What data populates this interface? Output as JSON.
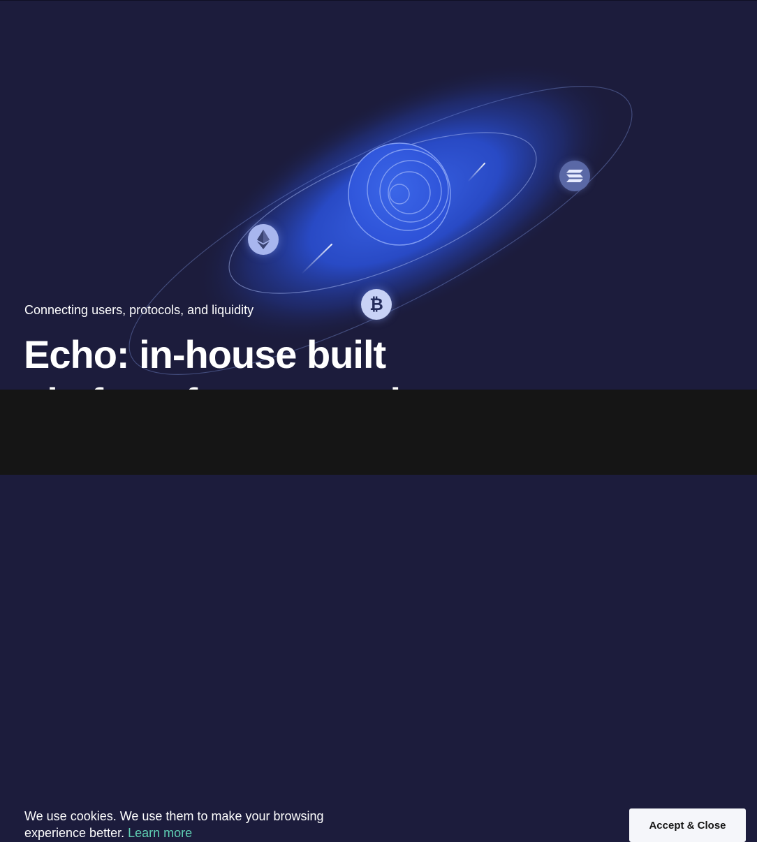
{
  "hero": {
    "tagline": "Connecting users, protocols, and liquidity",
    "headline": "Echo: in-house built platform for connecting"
  },
  "coins": [
    {
      "name": "ethereum",
      "icon": "ethereum-icon"
    },
    {
      "name": "bitcoin",
      "icon": "bitcoin-icon"
    },
    {
      "name": "solana",
      "icon": "solana-icon"
    }
  ],
  "cookie_banner": {
    "message": "We use cookies. We use them to make your browsing experience better.",
    "learn_more": "Learn more",
    "accept_label": "Accept & Close"
  },
  "colors": {
    "background": "#1c1c3c",
    "glow": "#2f52d6",
    "accent_link": "#5fd0b4",
    "banner": "#151515",
    "button": "#f5f6fa"
  }
}
